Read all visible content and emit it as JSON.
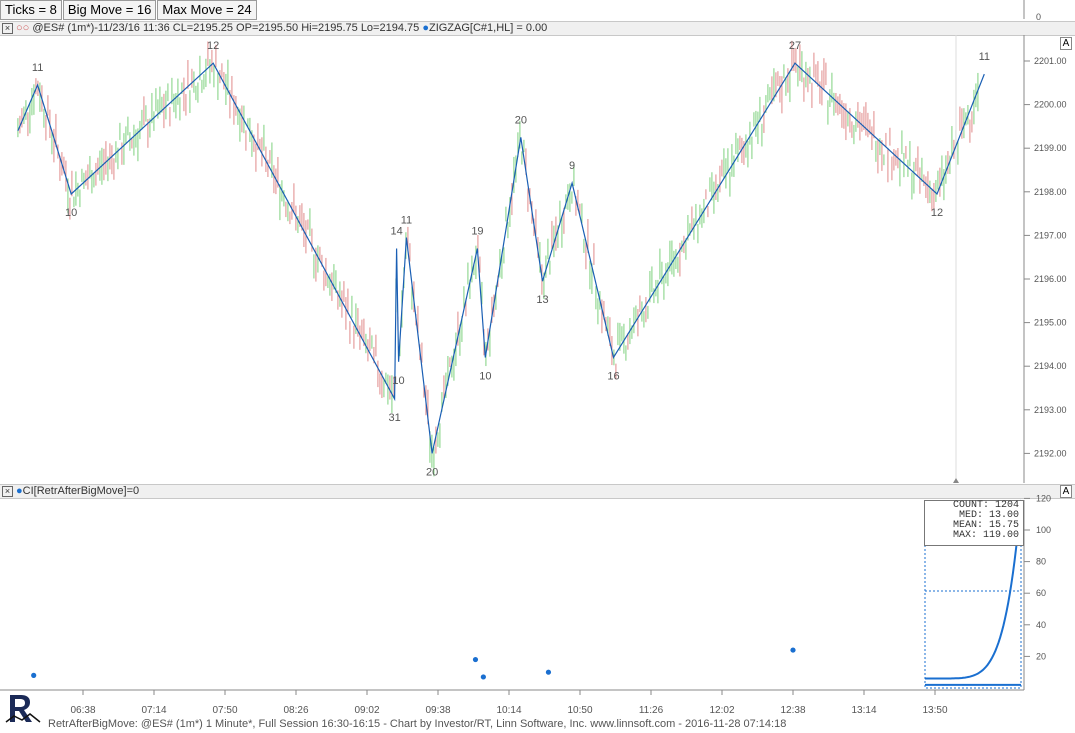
{
  "params": [
    {
      "label": "Ticks = 8"
    },
    {
      "label": "Big Move = 16"
    },
    {
      "label": "Max Move = 24"
    }
  ],
  "price_pane": {
    "header": "@ES# (1m*)-11/23/16 11:36 CL=2195.25 OP=2195.50 Hi=2195.75 Lo=2194.75",
    "indicator": "ZIGZAG[C#1,HL] = 0.00",
    "a_button": "A"
  },
  "ind_pane": {
    "header": "CI[RetrAfterBigMove]=0",
    "a_button": "A"
  },
  "top_axis_label": "0",
  "stats": {
    "count": "COUNT: 1204",
    "med": "MED: 13.00",
    "mean": "MEAN: 15.75",
    "max": "MAX: 119.00"
  },
  "footer": "RetrAfterBigMove: @ES# (1m*) 1 Minute*, Full Session 16:30-16:15 - Chart by Investor/RT, Linn Software, Inc. www.linnsoft.com - 2016-11-28 07:14:18",
  "colors": {
    "zigzag": "#1a5fb4",
    "up_bar": "#7ed17e",
    "down_bar": "#e08a8a",
    "dots": "#1a6fd0"
  },
  "chart_data": [
    {
      "type": "line",
      "title": "ZIGZAG[C#1,HL]",
      "ylim": [
        2191.6,
        2201.6
      ],
      "y_ticks": [
        "2192.00",
        "2193.00",
        "2194.00",
        "2195.00",
        "2196.00",
        "2197.00",
        "2198.00",
        "2199.00",
        "2200.00",
        "2201.00"
      ],
      "x_ticks": [
        "06:38",
        "07:14",
        "07:50",
        "08:26",
        "09:02",
        "09:38",
        "10:14",
        "10:50",
        "11:26",
        "12:02",
        "12:38",
        "13:14",
        "13:50"
      ],
      "zigzag": [
        {
          "t": "06:05",
          "price": 2199.4
        },
        {
          "t": "06:15",
          "price": 2200.45,
          "label": "11"
        },
        {
          "t": "06:32",
          "price": 2197.95,
          "label": "10"
        },
        {
          "t": "07:44",
          "price": 2200.95,
          "label": "12"
        },
        {
          "t": "09:16",
          "price": 2193.25,
          "label": "31"
        },
        {
          "t": "09:17",
          "price": 2196.7,
          "label": "14"
        },
        {
          "t": "09:18",
          "price": 2194.1,
          "label": "10"
        },
        {
          "t": "09:22",
          "price": 2196.95,
          "label": "11"
        },
        {
          "t": "09:35",
          "price": 2192.0,
          "label": "20"
        },
        {
          "t": "09:58",
          "price": 2196.7,
          "label": "19"
        },
        {
          "t": "10:02",
          "price": 2194.2,
          "label": "10"
        },
        {
          "t": "10:20",
          "price": 2199.25,
          "label": "20"
        },
        {
          "t": "10:31",
          "price": 2195.95,
          "label": "13"
        },
        {
          "t": "10:46",
          "price": 2198.2,
          "label": "9"
        },
        {
          "t": "11:07",
          "price": 2194.2,
          "label": "16"
        },
        {
          "t": "12:39",
          "price": 2200.95,
          "label": "27"
        },
        {
          "t": "13:51",
          "price": 2197.95,
          "label": "12"
        },
        {
          "t": "14:15",
          "price": 2200.7,
          "label": "11"
        }
      ]
    },
    {
      "type": "scatter",
      "title": "CI[RetrAfterBigMove]",
      "ylim": [
        0,
        125
      ],
      "y_ticks": [
        "20",
        "40",
        "60",
        "80",
        "100",
        "120"
      ],
      "points": [
        {
          "t": "06:13",
          "y": 8
        },
        {
          "t": "09:57",
          "y": 18
        },
        {
          "t": "10:01",
          "y": 7
        },
        {
          "t": "10:34",
          "y": 10
        },
        {
          "t": "12:38",
          "y": 24
        }
      ],
      "distribution": {
        "median": 13.0,
        "mean": 15.75,
        "max": 119.0,
        "count": 1204
      }
    }
  ]
}
